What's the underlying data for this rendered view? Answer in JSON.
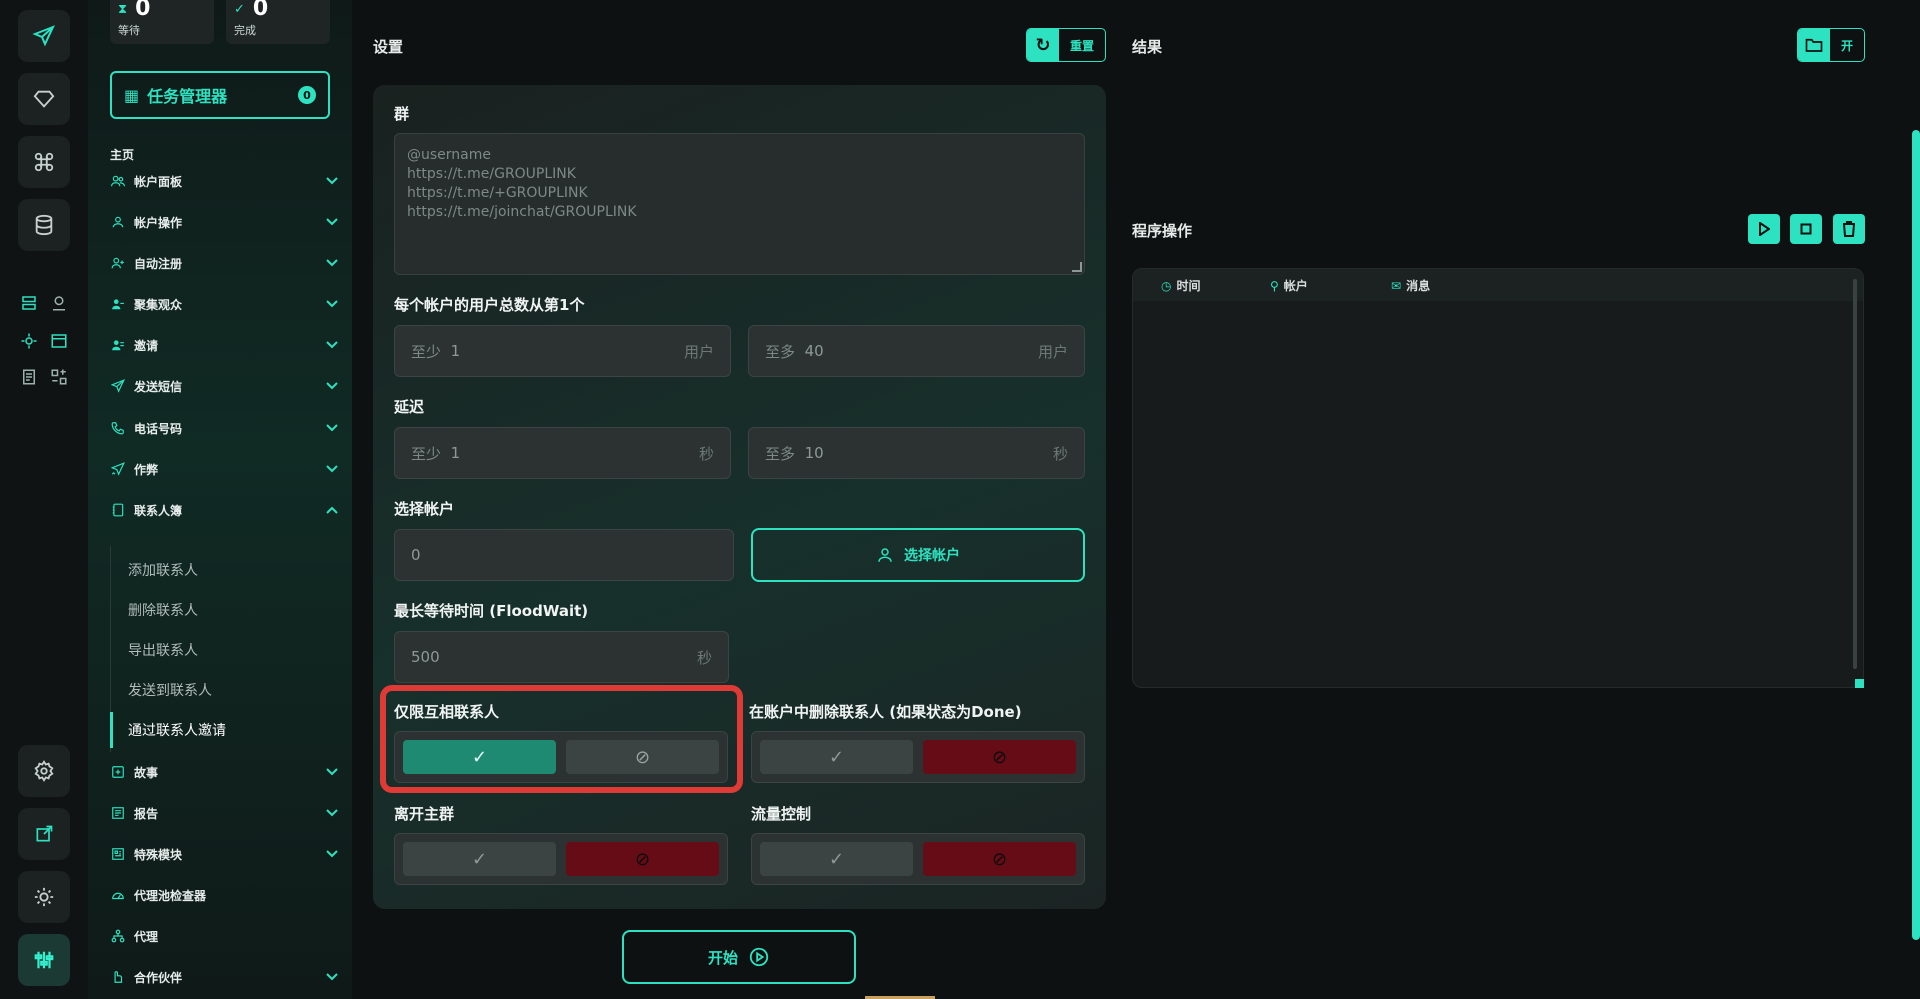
{
  "stats": [
    {
      "icon": "hourglass-icon",
      "value": "0",
      "label": "等待"
    },
    {
      "icon": "check-circle-icon",
      "value": "0",
      "label": "完成"
    }
  ],
  "task_manager": {
    "label": "任务管理器",
    "count": "0"
  },
  "sidebar": {
    "home_label": "主页",
    "items": [
      {
        "label": "帐户面板",
        "icon": "users-icon",
        "chevron": "down"
      },
      {
        "label": "帐户操作",
        "icon": "user-icon",
        "chevron": "down"
      },
      {
        "label": "自动注册",
        "icon": "user-plus-icon",
        "chevron": "down"
      },
      {
        "label": "聚集观众",
        "icon": "audience-icon",
        "chevron": "down"
      },
      {
        "label": "邀请",
        "icon": "invite-icon",
        "chevron": "down"
      },
      {
        "label": "发送短信",
        "icon": "send-icon",
        "chevron": "down"
      },
      {
        "label": "电话号码",
        "icon": "phone-icon",
        "chevron": "down"
      },
      {
        "label": "作弊",
        "icon": "cheat-icon",
        "chevron": "down"
      },
      {
        "label": "联系人簿",
        "icon": "contacts-book-icon",
        "chevron": "up"
      },
      {
        "label": "故事",
        "icon": "story-icon",
        "chevron": "down"
      },
      {
        "label": "报告",
        "icon": "report-icon",
        "chevron": "down"
      },
      {
        "label": "特殊模块",
        "icon": "modules-icon",
        "chevron": "down"
      },
      {
        "label": "代理池检查器",
        "icon": "gauge-icon",
        "chevron": ""
      },
      {
        "label": "代理",
        "icon": "network-icon",
        "chevron": ""
      },
      {
        "label": "合作伙伴",
        "icon": "handshake-icon",
        "chevron": "down"
      }
    ],
    "sub_items": [
      {
        "label": "添加联系人",
        "active": false
      },
      {
        "label": "删除联系人",
        "active": false
      },
      {
        "label": "导出联系人",
        "active": false
      },
      {
        "label": "发送到联系人",
        "active": false
      },
      {
        "label": "通过联系人邀请",
        "active": true
      }
    ]
  },
  "settings": {
    "title": "设置",
    "reset_label": "重置",
    "group_label": "群",
    "group_placeholder": "@username\nhttps://t.me/GROUPLINK\nhttps://t.me/+GROUPLINK\nhttps://t.me/joinchat/GROUPLINK",
    "users_label": "每个帐户的用户总数从第1个",
    "users_min": {
      "prefix": "至少",
      "value": "1",
      "unit": "用户"
    },
    "users_max": {
      "prefix": "至多",
      "value": "40",
      "unit": "用户"
    },
    "delay_label": "延迟",
    "delay_min": {
      "prefix": "至少",
      "value": "1",
      "unit": "秒"
    },
    "delay_max": {
      "prefix": "至多",
      "value": "10",
      "unit": "秒"
    },
    "select_account_label": "选择帐户",
    "select_account_value": "0",
    "select_account_button": "选择帐户",
    "floodwait_label": "最长等待时间 (FloodWait)",
    "floodwait_value": "500",
    "floodwait_unit": "秒",
    "toggles": [
      {
        "label": "仅限互相联系人",
        "value": true
      },
      {
        "label": "在账户中删除联系人 (如果状态为Done)",
        "value": false
      },
      {
        "label": "离开主群",
        "value": false
      },
      {
        "label": "流量控制",
        "value": false
      }
    ],
    "start_label": "开始"
  },
  "results": {
    "title": "结果",
    "open_label": "开",
    "program_ops_label": "程序操作",
    "log_columns": [
      {
        "label": "时间",
        "icon": "clock-icon"
      },
      {
        "label": "帐户",
        "icon": "user-icon"
      },
      {
        "label": "消息",
        "icon": "mail-icon"
      }
    ]
  },
  "colors": {
    "accent": "#2de2c0",
    "danger": "#650c16",
    "success": "#1f8a72",
    "highlight": "#e03a36"
  }
}
